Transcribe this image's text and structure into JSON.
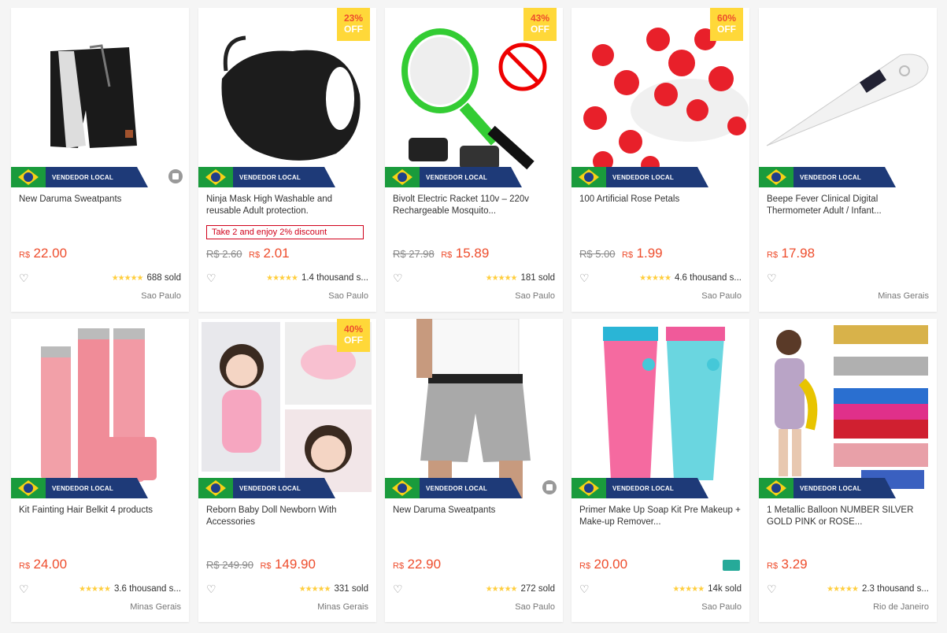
{
  "local_badge": "VENDEDOR LOCAL",
  "off_label": "OFF",
  "currency": "R$",
  "products": [
    {
      "title": "New Daruma Sweatpants",
      "price": "22.00",
      "sold": "688 sold",
      "location": "Sao Paulo"
    },
    {
      "title": "Ninja Mask High Washable and reusable Adult protection.",
      "discount": "23%",
      "promo": "Take 2 and enjoy 2% discount",
      "old_price": "R$ 2.60",
      "price": "2.01",
      "sold": "1.4 thousand s...",
      "location": "Sao Paulo"
    },
    {
      "title": "Bivolt Electric Racket 110v – 220v Rechargeable Mosquito...",
      "discount": "43%",
      "old_price": "R$ 27.98",
      "price": "15.89",
      "sold": "181 sold",
      "location": "Sao Paulo"
    },
    {
      "title": "100 Artificial Rose Petals",
      "discount": "60%",
      "old_price": "R$ 5.00",
      "price": "1.99",
      "sold": "4.6 thousand s...",
      "location": "Sao Paulo"
    },
    {
      "title": "Beepe Fever Clinical Digital Thermometer Adult / Infant...",
      "price": "17.98",
      "location": "Minas Gerais"
    },
    {
      "title": "Kit Fainting Hair Belkit 4 products",
      "price": "24.00",
      "sold": "3.6 thousand s...",
      "location": "Minas Gerais"
    },
    {
      "title": "Reborn Baby Doll Newborn With Accessories",
      "discount": "40%",
      "old_price": "R$ 249.90",
      "price": "149.90",
      "sold": "331 sold",
      "location": "Minas Gerais"
    },
    {
      "title": "New Daruma Sweatpants",
      "price": "22.90",
      "sold": "272 sold",
      "location": "Sao Paulo"
    },
    {
      "title": "Primer Make Up Soap Kit Pre Makeup + Make-up Remover...",
      "price": "20.00",
      "sold": "14k sold",
      "location": "Sao Paulo"
    },
    {
      "title": "1 Metallic Balloon NUMBER SILVER GOLD PINK or ROSE...",
      "price": "3.29",
      "sold": "2.3 thousand s...",
      "location": "Rio de Janeiro"
    }
  ],
  "colors": {
    "accent": "#ee4d2d",
    "badge": "#ffd839",
    "local": "#1e3a78",
    "star": "#ffce3d"
  }
}
